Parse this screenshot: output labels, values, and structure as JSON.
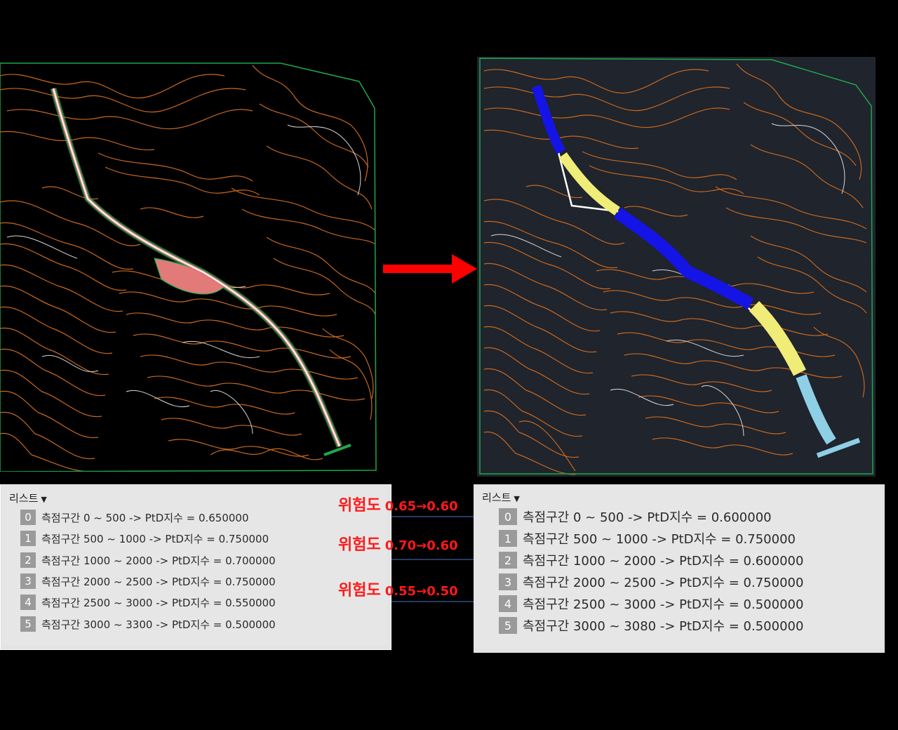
{
  "colors": {
    "contour": "#c8681e",
    "contour_white": "#d8d8d8",
    "boundary": "#1ea84a",
    "arrow": "#ff0000",
    "connector": "#4a74c9",
    "risk_text": "#ff1a1a",
    "seg_blue": "#1414e6",
    "seg_yellow": "#f0ec78",
    "seg_cyan": "#8ecfe6"
  },
  "before_list": {
    "title": "리스트",
    "rows": [
      {
        "index": "0",
        "text": "측점구간 0 ~ 500 -> PtD지수 = 0.650000"
      },
      {
        "index": "1",
        "text": "측점구간 500 ~ 1000 -> PtD지수 = 0.750000"
      },
      {
        "index": "2",
        "text": "측점구간 1000 ~ 2000 -> PtD지수 = 0.700000"
      },
      {
        "index": "3",
        "text": "측점구간 2000 ~ 2500 -> PtD지수 = 0.750000"
      },
      {
        "index": "4",
        "text": "측점구간 2500 ~ 3000 -> PtD지수 = 0.550000"
      },
      {
        "index": "5",
        "text": "측점구간 3000 ~ 3300 -> PtD지수 = 0.500000"
      }
    ]
  },
  "after_list": {
    "title": "리스트",
    "rows": [
      {
        "index": "0",
        "text": "측점구간 0 ~ 500 -> PtD지수 = 0.600000"
      },
      {
        "index": "1",
        "text": "측점구간 500 ~ 1000 -> PtD지수 = 0.750000"
      },
      {
        "index": "2",
        "text": "측점구간 1000 ~ 2000 -> PtD지수 = 0.600000"
      },
      {
        "index": "3",
        "text": "측점구간 2000 ~ 2500 -> PtD지수 = 0.750000"
      },
      {
        "index": "4",
        "text": "측점구간 2500 ~ 3000 -> PtD지수 = 0.500000"
      },
      {
        "index": "5",
        "text": "측점구간 3000 ~ 3080 -> PtD지수 = 0.500000"
      }
    ]
  },
  "risk_labels": [
    {
      "label": "위험도",
      "change": "0.65→0.60"
    },
    {
      "label": "위험도",
      "change": "0.70→0.60"
    },
    {
      "label": "위험도",
      "change": "0.55→0.50"
    }
  ],
  "caret_symbol": "▼"
}
